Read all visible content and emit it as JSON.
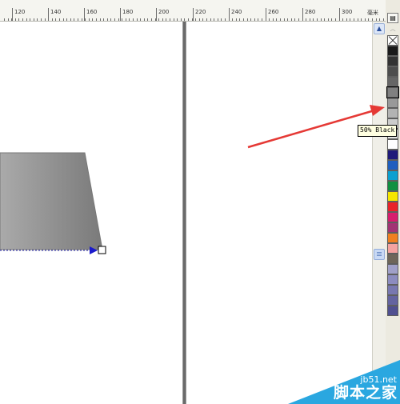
{
  "ruler": {
    "labels": [
      "120",
      "140",
      "160",
      "180",
      "200",
      "220",
      "240",
      "260",
      "280",
      "300"
    ],
    "unit": "毫米"
  },
  "palette": {
    "menu_icon": "palette-menu-icon",
    "scroll_up_icon": "chevron-up-icon",
    "swatches": [
      "#ffffff",
      "#1a1a1a",
      "#333333",
      "#4d4d4d",
      "#666666",
      "#808080",
      "#999999",
      "#b3b3b3",
      "#cccccc",
      "#e6e6e6",
      "#ffffff",
      "#1f1a7a",
      "#1f5fbf",
      "#0aa0d0",
      "#109040",
      "#f5e600",
      "#e8232a",
      "#d61e6e",
      "#a23474",
      "#f08020",
      "#f5a3a0",
      "#6e6659",
      "#a0a0c8",
      "#8c8cbf",
      "#7878b0",
      "#6464a0",
      "#505090"
    ],
    "hovered_swatch_color": "#808080",
    "tooltip": "50% Black"
  },
  "scrollbar": {
    "up_icon": "scroll-up-arrow-icon",
    "thumb_icon": "scroll-thumb-grip-icon"
  },
  "watermark": {
    "site": "jb51.net",
    "name": "脚本之家",
    "color": "#2aa7e0"
  },
  "colors": {
    "arrow": "#e53935",
    "shape_gradient_start": "#aaaaaa",
    "shape_gradient_end": "#7a7a7a",
    "selection_handle": "#1a1acc"
  }
}
